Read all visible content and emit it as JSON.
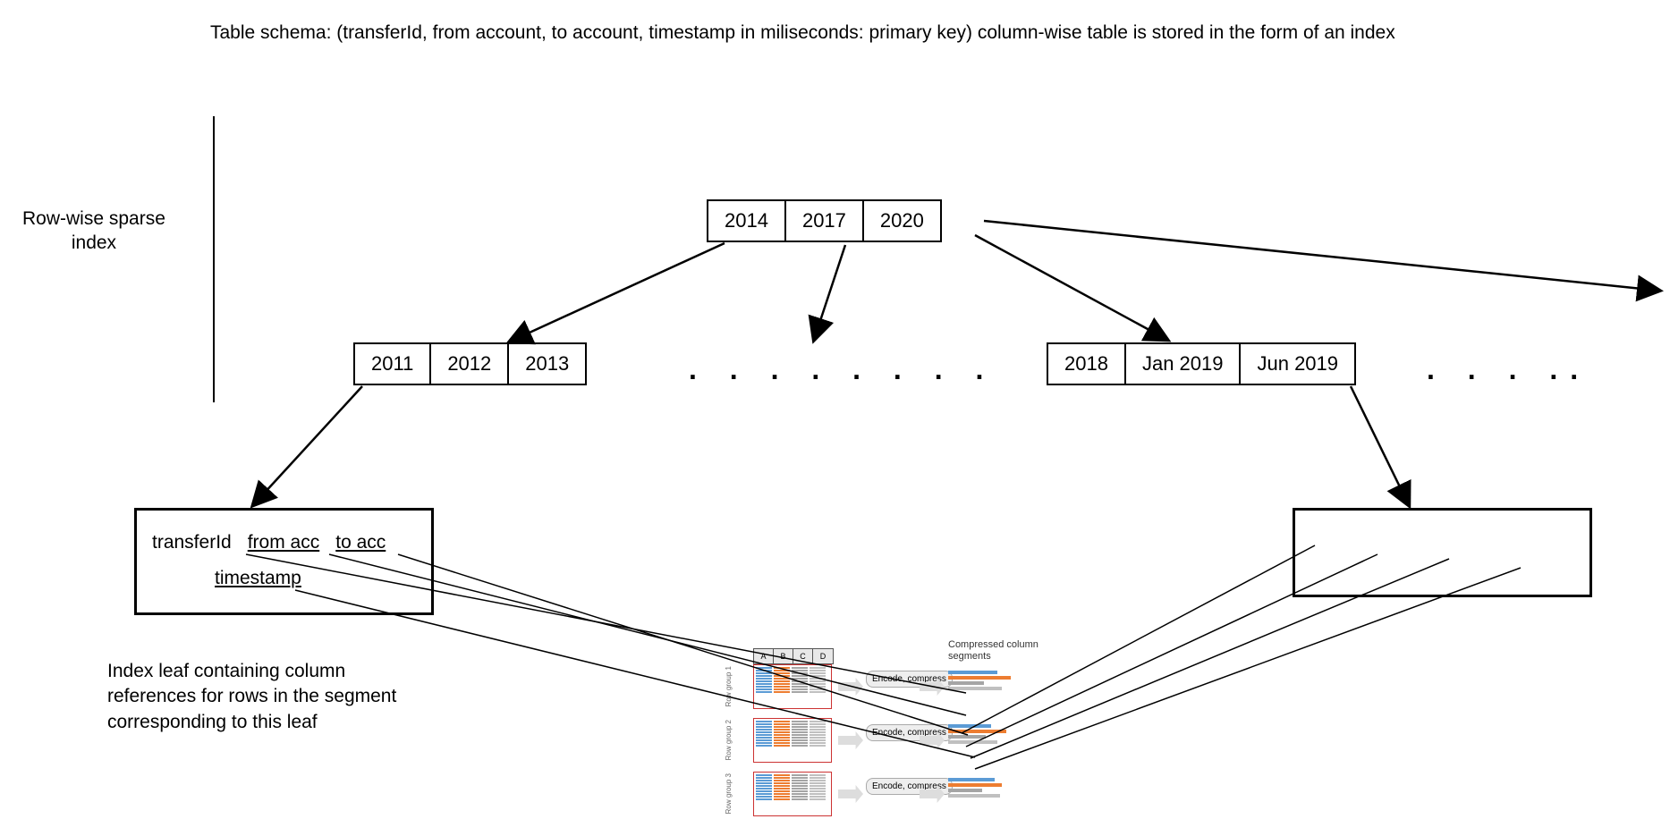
{
  "title": "Table schema: (transferId, from account, to account, timestamp in miliseconds: primary key) column-wise table is stored in the form of an index",
  "side_label_line1": "Row-wise sparse",
  "side_label_line2": "index",
  "root": {
    "cells": [
      "2014",
      "2017",
      "2020"
    ]
  },
  "level1_left": {
    "cells": [
      "2011",
      "2012",
      "2013"
    ]
  },
  "level1_right": {
    "cells": [
      "2018",
      "Jan 2019",
      "Jun 2019"
    ]
  },
  "dots_middle": ". . . . . . . .",
  "dots_right": ". . . ..",
  "leaf_left": {
    "col1": "transferId",
    "col2": "from acc",
    "col3": "to acc",
    "col4": "timestamp"
  },
  "leaf_caption_line1": "Index leaf containing column",
  "leaf_caption_line2": "references for rows in the segment",
  "leaf_caption_line3": "corresponding to this leaf",
  "col_diagram": {
    "headers": [
      "A",
      "B",
      "C",
      "D"
    ],
    "rowgroups": [
      "Row group 1",
      "Row group 2",
      "Row group 3"
    ],
    "encode_label": "Encode, compress",
    "compressed_label": "Compressed column segments"
  }
}
